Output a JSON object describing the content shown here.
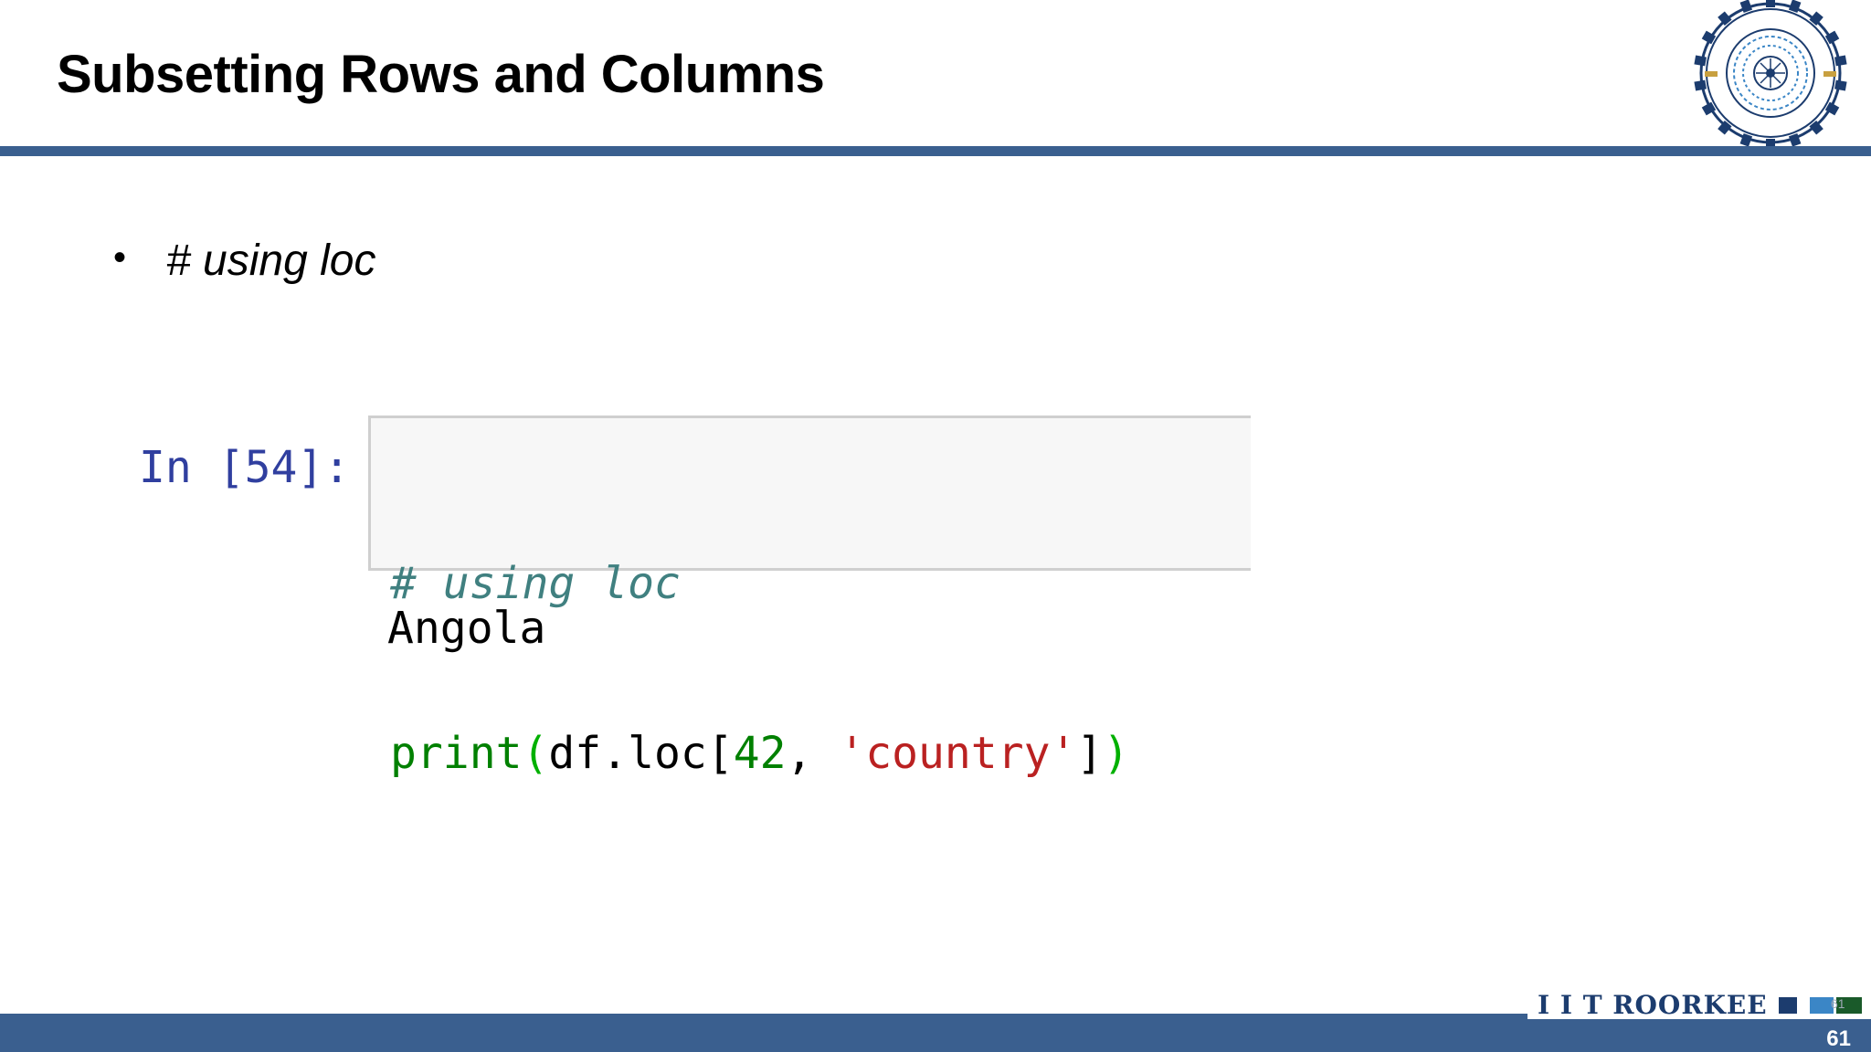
{
  "slide": {
    "title": "Subsetting Rows and Columns",
    "bullet": "# using loc"
  },
  "notebook_cell": {
    "prompt": "In [54]:",
    "code_comment": "# using loc",
    "code_fn": "print",
    "code_open": "(",
    "code_obj": "df.loc[",
    "code_num": "42",
    "code_sep": ", ",
    "code_str": "'country'",
    "code_close_bracket": "]",
    "code_close": ")",
    "output": "Angola"
  },
  "footer": {
    "brand": "I I T ROORKEE",
    "mini_page": "61",
    "page_number": "61"
  },
  "logo": {
    "seal_top_text": "भारतीय प्रौद्योगिकी संस्थान रुड़की",
    "seal_bottom_text": "INDIAN INSTITUTE OF TECHNOLOGY ROORKEE"
  },
  "colors": {
    "accent": "#3a5f8f",
    "brand": "#1c3c6e"
  }
}
